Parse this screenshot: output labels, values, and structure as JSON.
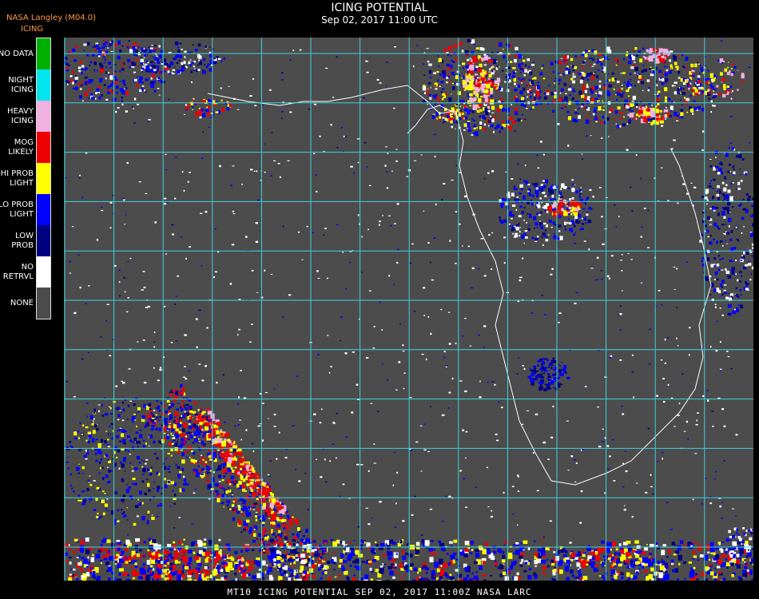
{
  "header": {
    "title": "ICING POTENTIAL",
    "subtitle": "Sep 02, 2017 11:00 UTC",
    "source": "NASA Langley (M04.0)",
    "product": "ICING"
  },
  "legend": {
    "items": [
      {
        "line1": "NO DATA",
        "line2": "",
        "color": "#00b000"
      },
      {
        "line1": "NIGHT",
        "line2": "ICING",
        "color": "#00e5ee"
      },
      {
        "line1": "HEAVY",
        "line2": "ICING",
        "color": "#f0b0e0"
      },
      {
        "line1": "MOG",
        "line2": "LIKELY",
        "color": "#ee0000"
      },
      {
        "line1": "HI PROB",
        "line2": "LIGHT",
        "color": "#ffff00"
      },
      {
        "line1": "LO PROB",
        "line2": "LIGHT",
        "color": "#0000ff"
      },
      {
        "line1": "LOW",
        "line2": "PROB",
        "color": "#000080"
      },
      {
        "line1": "NO",
        "line2": "RETRVL",
        "color": "#ffffff"
      },
      {
        "line1": "NONE",
        "line2": "",
        "color": "#4c4c4c"
      }
    ]
  },
  "map": {
    "background_color": "#4c4c4c",
    "grid_color": "#3fd0e0",
    "coast_color": "#ffffff",
    "tick_label_color": "#cc2222"
  },
  "footer": {
    "text": "MT10  ICING POTENTIAL   SEP 02, 2017 11:00Z   NASA LARC"
  }
}
